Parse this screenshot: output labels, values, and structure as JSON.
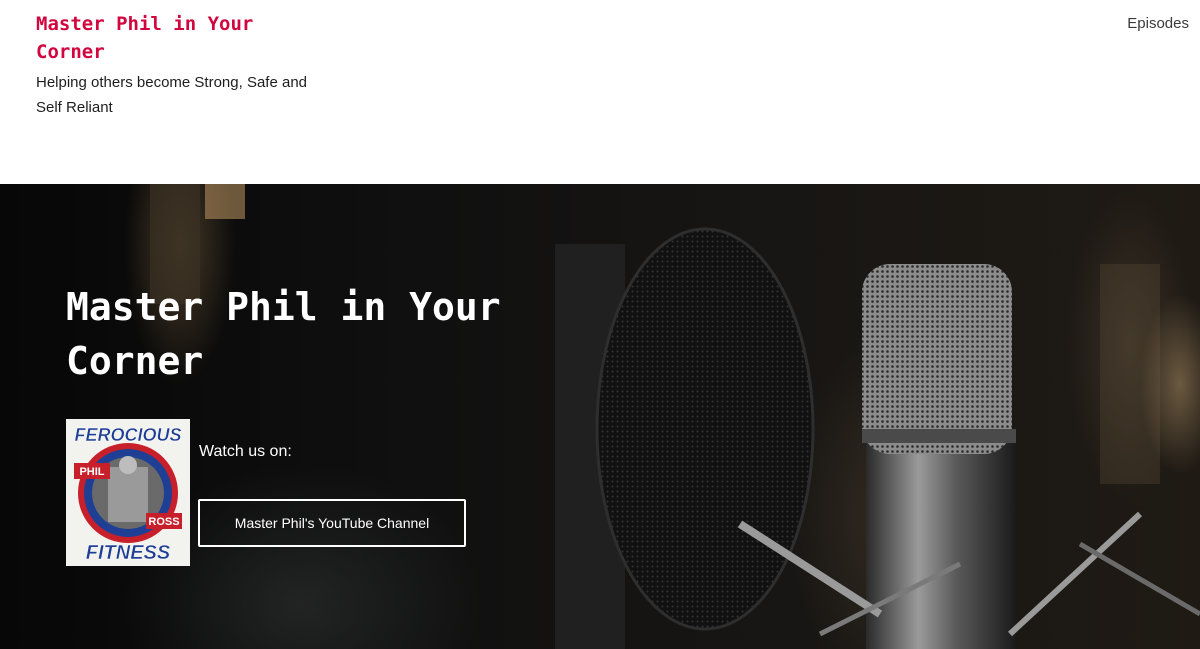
{
  "header": {
    "site_title": "Master Phil in Your Corner",
    "tagline": "Helping others become Strong, Safe and Self Reliant",
    "nav": {
      "episodes_label": "Episodes"
    }
  },
  "hero": {
    "title": "Master Phil in Your Corner",
    "watch_label": "Watch us on:",
    "youtube_button_label": "Master Phil's YouTube Channel",
    "logo": {
      "top_text": "FEROCIOUS",
      "bottom_text": "FITNESS",
      "name_left": "PHIL",
      "name_right": "ROSS"
    }
  },
  "colors": {
    "brand": "#d1063f",
    "hero_text": "#ffffff",
    "logo_blue": "#1f3f95",
    "logo_red": "#c8202a"
  }
}
